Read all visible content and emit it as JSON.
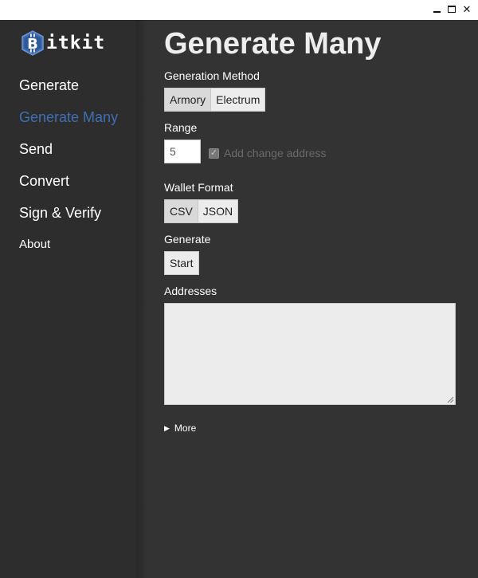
{
  "window": {
    "minimize_icon": "minimize-icon",
    "maximize_icon": "maximize-icon",
    "close_glyph": "✕"
  },
  "logo": {
    "badge_glyph": "B",
    "text": "itkit",
    "accent_color": "#3f6fb5"
  },
  "sidebar": {
    "items": [
      {
        "label": "Generate"
      },
      {
        "label": "Generate Many"
      },
      {
        "label": "Send"
      },
      {
        "label": "Convert"
      },
      {
        "label": "Sign & Verify"
      },
      {
        "label": "About"
      }
    ],
    "active_index": 1
  },
  "main": {
    "title": "Generate Many",
    "generation_method": {
      "label": "Generation Method",
      "options": [
        "Armory",
        "Electrum"
      ],
      "selected": "Armory"
    },
    "range": {
      "label": "Range",
      "value": "5",
      "change_address_label": "Add change address",
      "change_address_checked": true
    },
    "wallet_format": {
      "label": "Wallet Format",
      "options": [
        "CSV",
        "JSON"
      ],
      "selected": "CSV"
    },
    "generate": {
      "label": "Generate",
      "button_label": "Start"
    },
    "addresses": {
      "label": "Addresses",
      "value": ""
    },
    "more": {
      "label": "More",
      "arrow": "▶"
    }
  }
}
